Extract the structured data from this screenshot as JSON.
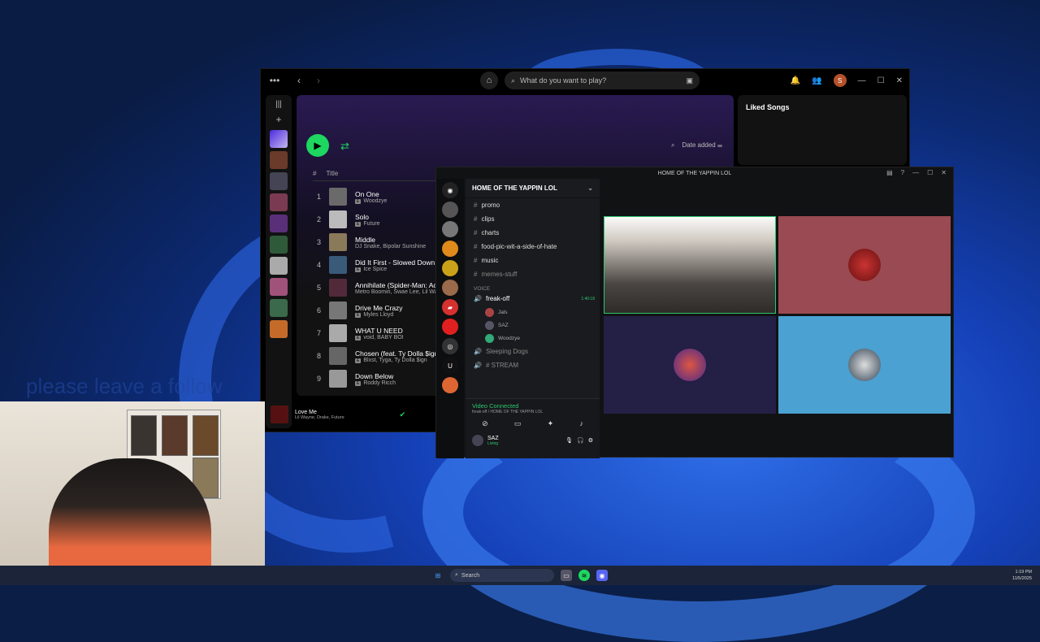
{
  "desktop": {
    "ghost_text": "please leave a follow"
  },
  "spotify": {
    "search_placeholder": "What do you want to play?",
    "sort_label": "Date added",
    "col_num": "#",
    "col_title": "Title",
    "right_pane_title": "Liked Songs",
    "tracks": [
      {
        "n": "1",
        "title": "On One",
        "artist": "Woodzye",
        "explicit": true
      },
      {
        "n": "2",
        "title": "Solo",
        "artist": "Future",
        "explicit": true
      },
      {
        "n": "3",
        "title": "Middle",
        "artist": "DJ Snake, Bipolar Sunshine",
        "explicit": false
      },
      {
        "n": "4",
        "title": "Did It First - Slowed Down",
        "artist": "Ice Spice",
        "explicit": true
      },
      {
        "n": "5",
        "title": "Annihilate (Spider-Man: Across",
        "artist": "Metro Boomin, Swae Lee, Lil Wayne",
        "explicit": false
      },
      {
        "n": "6",
        "title": "Drive Me Crazy",
        "artist": "Myles Lloyd",
        "explicit": true
      },
      {
        "n": "7",
        "title": "WHAT U NEED",
        "artist": "void, BABY BOI",
        "explicit": true
      },
      {
        "n": "8",
        "title": "Chosen (feat. Ty Dolla $ign)",
        "artist": "Blxst, Tyga, Ty Dolla $ign",
        "explicit": true
      },
      {
        "n": "9",
        "title": "Down Below",
        "artist": "Roddy Ricch",
        "explicit": true
      }
    ],
    "now_playing": {
      "title": "Love Me",
      "artist": "Lil Wayne, Drake, Future"
    },
    "avatar_letter": "S"
  },
  "discord": {
    "window_title": "HOME OF THE YAPPIN LOL",
    "guild_name": "HOME OF THE YAPPIN LOL",
    "channels": [
      {
        "name": "promo"
      },
      {
        "name": "clips"
      },
      {
        "name": "charts"
      },
      {
        "name": "food-pic-wit-a-side-of-hate"
      },
      {
        "name": "music"
      },
      {
        "name": "memes-stuff"
      }
    ],
    "voice_category": "VOICE",
    "voice_channel": "freak-off",
    "voice_timer": "1:40:18",
    "voice_users": [
      "Jals",
      "SAZ",
      "Woodzye"
    ],
    "other_voice": [
      "Sleeping Dogs",
      "# STREAM"
    ],
    "video_status": "Video Connected",
    "video_sub": "freak-off / HOME OF THE YAPPIN LOL",
    "user_name": "SAZ",
    "user_status": "Living"
  },
  "taskbar": {
    "search": "Search",
    "time": "1:19 PM",
    "date": "11/5/2025"
  },
  "colors": {
    "spotify_green": "#1ed760",
    "discord_green": "#2dc770"
  }
}
